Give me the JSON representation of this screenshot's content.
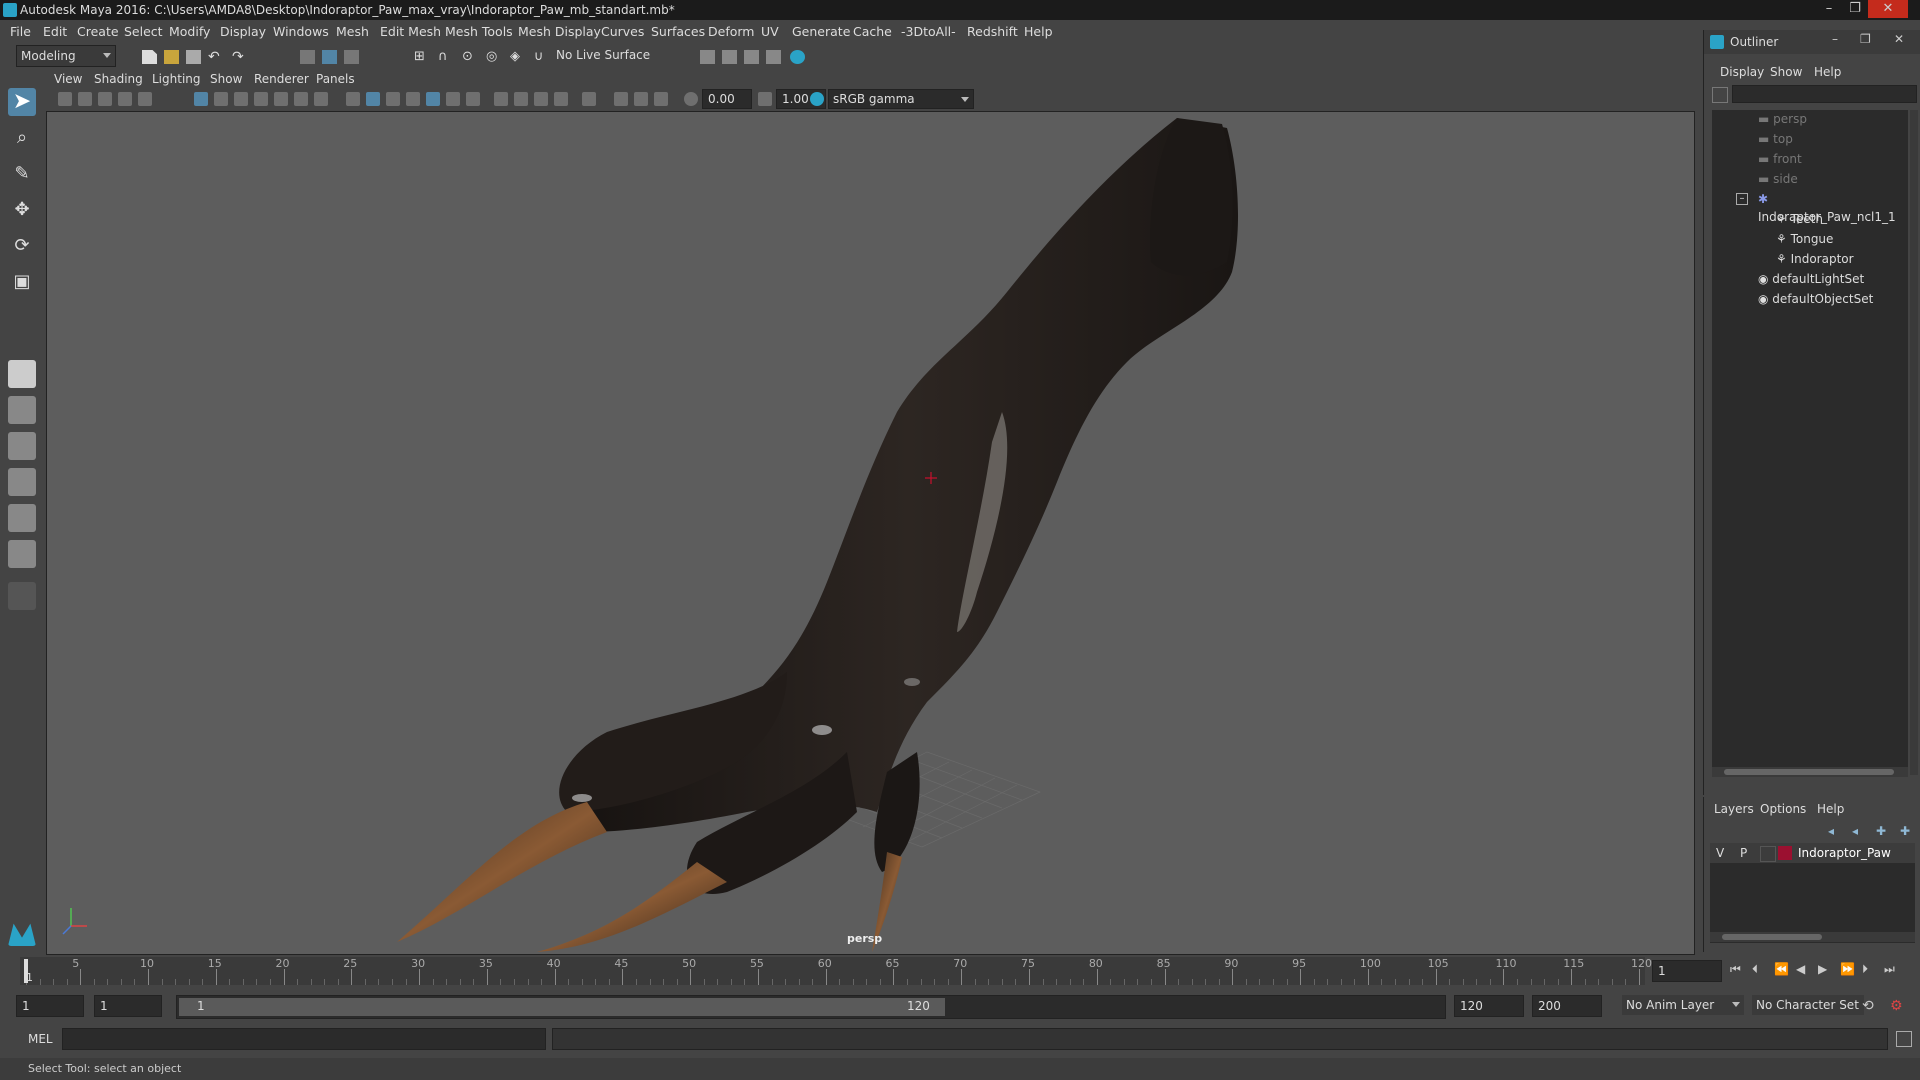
{
  "window": {
    "title": "Autodesk Maya 2016: C:\\Users\\AMDA8\\Desktop\\Indoraptor_Paw_max_vray\\Indoraptor_Paw_mb_standart.mb*"
  },
  "menubar": {
    "items": [
      "File",
      "Edit",
      "Create",
      "Select",
      "Modify",
      "Display",
      "Windows",
      "Mesh",
      "Edit Mesh",
      "Mesh Tools",
      "Mesh Display",
      "Curves",
      "Surfaces",
      "Deform",
      "UV",
      "Generate",
      "Cache",
      "-3DtoAll-",
      "Redshift",
      "Help"
    ]
  },
  "statusline": {
    "mode": "Modeling",
    "live_surface": "No Live Surface"
  },
  "panel_menu": {
    "items": [
      "View",
      "Shading",
      "Lighting",
      "Show",
      "Renderer",
      "Panels"
    ]
  },
  "viewport_toolbar": {
    "exposure": "0.00",
    "gamma": "1.00",
    "colorspace": "sRGB gamma"
  },
  "viewport": {
    "camera_label": "persp"
  },
  "outliner": {
    "title": "Outliner",
    "menu": [
      "Display",
      "Show",
      "Help"
    ],
    "items": [
      {
        "label": "persp",
        "dim": true
      },
      {
        "label": "top",
        "dim": true
      },
      {
        "label": "front",
        "dim": true
      },
      {
        "label": "side",
        "dim": true
      },
      {
        "label": "Indoraptor_Paw_ncl1_1",
        "dim": false
      },
      {
        "label": "Teeth",
        "dim": false
      },
      {
        "label": "Tongue",
        "dim": false
      },
      {
        "label": "Indoraptor",
        "dim": false
      },
      {
        "label": "defaultLightSet",
        "dim": false
      },
      {
        "label": "defaultObjectSet",
        "dim": false
      }
    ]
  },
  "layers": {
    "menu": [
      "Layers",
      "Options",
      "Help"
    ],
    "layer": {
      "v": "V",
      "p": "P",
      "name": "Indoraptor_Paw",
      "color": "#9b1030"
    }
  },
  "timeline": {
    "ticks": [
      "5",
      "10",
      "15",
      "20",
      "25",
      "30",
      "35",
      "40",
      "45",
      "50",
      "55",
      "60",
      "65",
      "70",
      "75",
      "80",
      "85",
      "90",
      "95",
      "100",
      "105",
      "110",
      "115",
      "120"
    ],
    "start_marker": "1",
    "current_frame": "1"
  },
  "range": {
    "start": "1",
    "anim_start": "1",
    "slider_start": "1",
    "slider_end": "120",
    "end": "120",
    "anim_end": "200",
    "anim_layer": "No Anim Layer",
    "character_set": "No Character Set"
  },
  "cmdline": {
    "label": "MEL"
  },
  "helpline": {
    "text": "Select Tool: select an object"
  },
  "colors": {
    "accent": "#5285a6",
    "maya_teal": "#2aa3c7"
  }
}
